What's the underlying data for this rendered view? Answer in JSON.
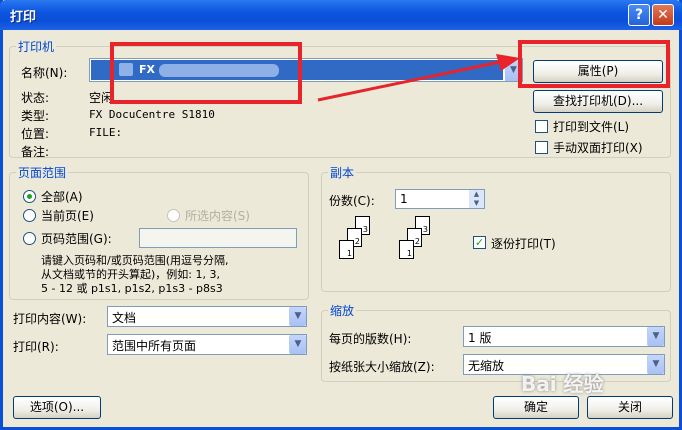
{
  "window": {
    "title": "打印",
    "help_label": "?",
    "close_label": "✕"
  },
  "printer": {
    "group_title": "打印机",
    "name_label": "名称(N):",
    "name_value": "FX",
    "status_label": "状态:",
    "status_value": "空闲",
    "type_label": "类型:",
    "type_value": "FX DocuCentre S1810",
    "where_label": "位置:",
    "where_value": "FILE:",
    "comment_label": "备注:",
    "properties_button": "属性(P)",
    "find_printer_button": "查找打印机(D)...",
    "print_to_file_label": "打印到文件(L)",
    "manual_duplex_label": "手动双面打印(X)",
    "print_to_file_checked": false,
    "manual_duplex_checked": false
  },
  "page_range": {
    "group_title": "页面范围",
    "all_label": "全部(A)",
    "current_label": "当前页(E)",
    "selection_label": "所选内容(S)",
    "pages_label": "页码范围(G):",
    "pages_value": "",
    "hint": "请键入页码和/或页码范围(用逗号分隔，从文档或节的开头算起)，例如: 1, 3, 5-12 或 p1s1, p1s2, p1s3-p8s3",
    "hint_line1": "请键入页码和/或页码范围(用逗号分隔,",
    "hint_line2": "从文档或节的开头算起)，例如: 1, 3,",
    "hint_line3": "5 - 12 或 p1s1, p1s2, p1s3 - p8s3",
    "selected": "all"
  },
  "copies": {
    "group_title": "副本",
    "count_label": "份数(C):",
    "count_value": "1",
    "collate_label": "逐份打印(T)",
    "collate_checked": true,
    "page_numbers": [
      "1",
      "2",
      "3"
    ]
  },
  "print_what": {
    "label": "打印内容(W):",
    "value": "文档"
  },
  "print": {
    "label": "打印(R):",
    "value": "范围中所有页面"
  },
  "zoom": {
    "group_title": "缩放",
    "pages_per_sheet_label": "每页的版数(H):",
    "pages_per_sheet_value": "1 版",
    "scale_label": "按纸张大小缩放(Z):",
    "scale_value": "无缩放"
  },
  "footer": {
    "options_button": "选项(O)...",
    "ok_button": "确定",
    "cancel_button": "关闭"
  },
  "watermark": "Bai 经验",
  "colors": {
    "title_bar": "#0a4fd8",
    "highlight": "#316ac5",
    "annotation": "#e8232a",
    "group_title": "#0046d5"
  }
}
